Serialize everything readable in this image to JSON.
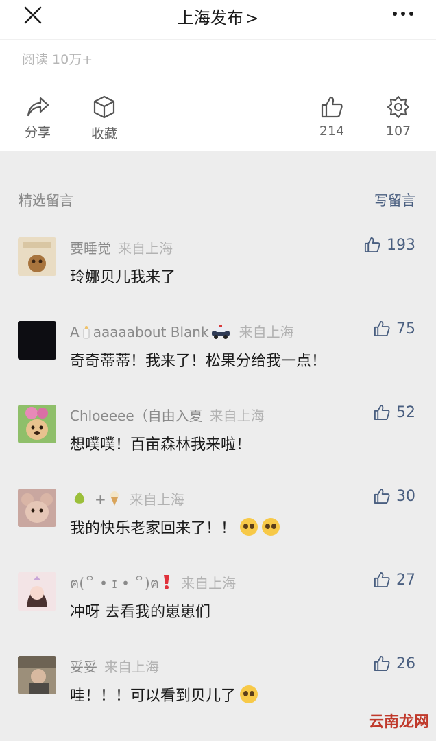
{
  "header": {
    "title": "上海发布",
    "chevron": ">"
  },
  "reads": "阅读 10万+",
  "actions": {
    "share_label": "分享",
    "collect_label": "收藏",
    "like_count": "214",
    "wow_count": "107"
  },
  "comments_section": {
    "title": "精选留言",
    "write_label": "写留言"
  },
  "comments": [
    {
      "nickname": "要睡觉",
      "location": "来自上海",
      "likes": "193",
      "text": "玲娜贝儿我来了"
    },
    {
      "nickname_a": "A",
      "nickname_b": "aaaaabout Blank",
      "location": "来自上海",
      "likes": "75",
      "text": "奇奇蒂蒂！我来了！松果分给我一点！"
    },
    {
      "nickname": "Chloeeee（自由入夏",
      "location": "来自上海",
      "likes": "52",
      "text": "想噗噗！百亩森林我来啦！"
    },
    {
      "nickname": "+",
      "location": "来自上海",
      "likes": "30",
      "text": "我的快乐老家回来了！！"
    },
    {
      "nickname": "ฅ(꒪ • ɪ • ꒪)ฅ",
      "location": "来自上海",
      "likes": "27",
      "text": "冲呀 去看我的崽崽们"
    },
    {
      "nickname": "妥妥",
      "location": "来自上海",
      "likes": "26",
      "text": "哇！！！可以看到贝儿了"
    }
  ],
  "watermark": "云南龙网",
  "colors": {
    "link": "#4a5f80",
    "muted": "#8a8a8a",
    "text": "#1a1a1a",
    "background": "#ededed"
  }
}
